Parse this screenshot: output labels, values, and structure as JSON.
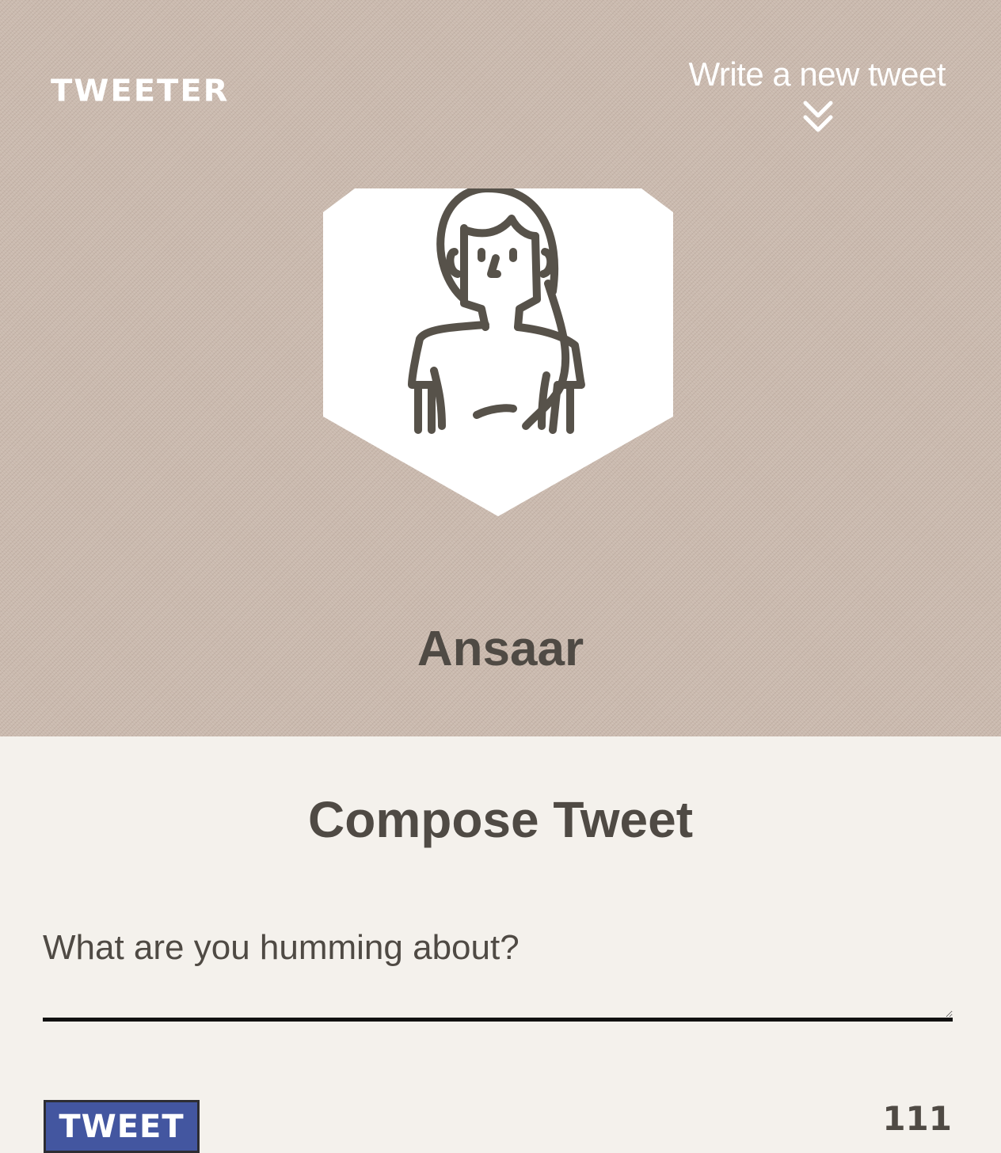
{
  "header": {
    "brand": "TWEETER",
    "new_tweet_label": "Write a new tweet",
    "toggle_icon": "chevron-double-down-icon"
  },
  "profile": {
    "avatar_icon": "woman-avatar-icon",
    "name": "Ansaar"
  },
  "compose": {
    "title": "Compose Tweet",
    "placeholder": "What are you humming about?",
    "value": "",
    "submit_label": "TWEET",
    "char_counter": "111"
  },
  "colors": {
    "header_bg": "#c9b8ac",
    "page_bg": "#f4f1ec",
    "text": "#4f4a44",
    "button_bg": "#4356a0"
  }
}
